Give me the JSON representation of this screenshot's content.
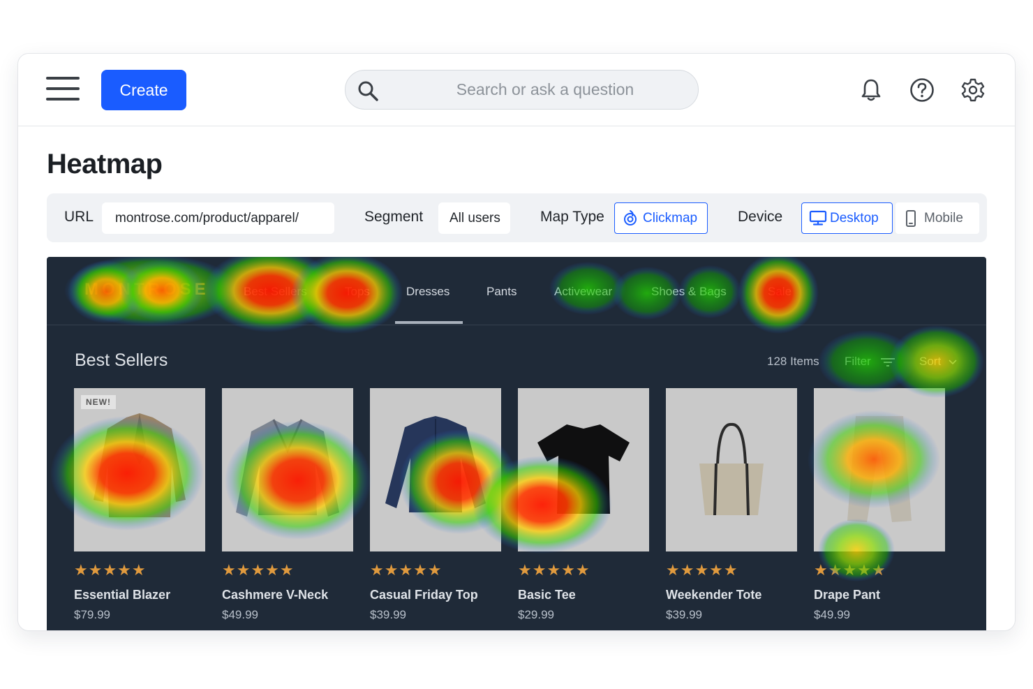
{
  "toolbar": {
    "create_label": "Create"
  },
  "search": {
    "placeholder": "Search or ask a question"
  },
  "page": {
    "title": "Heatmap"
  },
  "filters": {
    "url_label": "URL",
    "url_value": "montrose.com/product/apparel/",
    "segment_label": "Segment",
    "segment_value": "All users",
    "map_type_label": "Map Type",
    "map_type_value": "Clickmap",
    "device_label": "Device",
    "device_options": [
      "Desktop",
      "Mobile"
    ],
    "device_selected": "Desktop"
  },
  "store": {
    "logo": "MONTROSE",
    "nav": [
      "Best Sellers",
      "Tops",
      "Dresses",
      "Pants",
      "Activewear",
      "Shoes & Bags",
      "Sale"
    ],
    "active_nav": "Dresses",
    "section_title": "Best Sellers",
    "items_count": "128 Items",
    "filter_label": "Filter",
    "sort_label": "Sort",
    "products": [
      {
        "name": "Essential Blazer",
        "price": "$79.99",
        "rating": "★★★★★",
        "badge": "NEW!"
      },
      {
        "name": "Cashmere V-Neck",
        "price": "$49.99",
        "rating": "★★★★★"
      },
      {
        "name": "Casual Friday Top",
        "price": "$39.99",
        "rating": "★★★★★"
      },
      {
        "name": "Basic Tee",
        "price": "$29.99",
        "rating": "★★★★★"
      },
      {
        "name": "Weekender Tote",
        "price": "$39.99",
        "rating": "★★★★★"
      },
      {
        "name": "Drape Pant",
        "price": "$49.99",
        "rating": "★★★★★"
      }
    ]
  },
  "colors": {
    "accent": "#1a5cff",
    "preview_bg": "#1f2a38",
    "logo": "#e7763b",
    "stars": "#e09a3e"
  },
  "icons": [
    "menu-icon",
    "search-icon",
    "bell-icon",
    "help-icon",
    "gear-icon",
    "clickmap-icon",
    "desktop-icon",
    "mobile-icon",
    "filter-icon",
    "chevron-down-icon"
  ]
}
